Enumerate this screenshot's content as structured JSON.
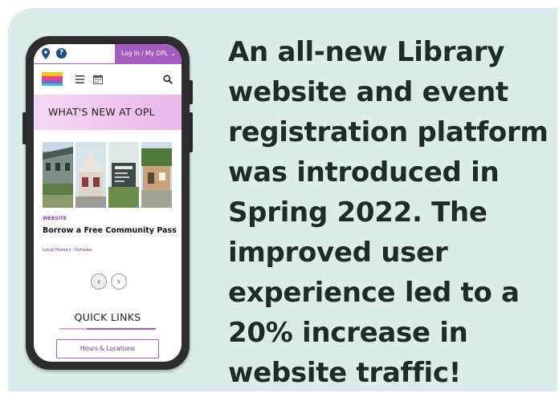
{
  "headline": "An all-new Library website and event registration platform was introduced in Spring 2022. The improved user experience led to a 20% increase in website traffic!",
  "phone": {
    "login_label": "Log In / My OPL",
    "login_chevron": "⌄",
    "help_glyph": "?",
    "banner_title": "WHAT'S NEW AT OPL",
    "article": {
      "tag": "WEBSITE",
      "title": "Borrow a Free Community Pass",
      "meta_1": "Local History",
      "meta_sep": "·",
      "meta_2": "Oshawa"
    },
    "prev_glyph": "‹",
    "next_glyph": "›",
    "quick_links_title": "QUICK LINKS",
    "hours_button": "Hours & Locations"
  },
  "colors": {
    "card_bg": "#dcecec",
    "accent_purple": "#a65bc1",
    "headline": "#1f2a2c"
  },
  "icons": [
    "map-pin-icon",
    "help-icon",
    "menu-icon",
    "calendar-icon",
    "search-icon",
    "chevron-left-icon",
    "chevron-right-icon"
  ]
}
